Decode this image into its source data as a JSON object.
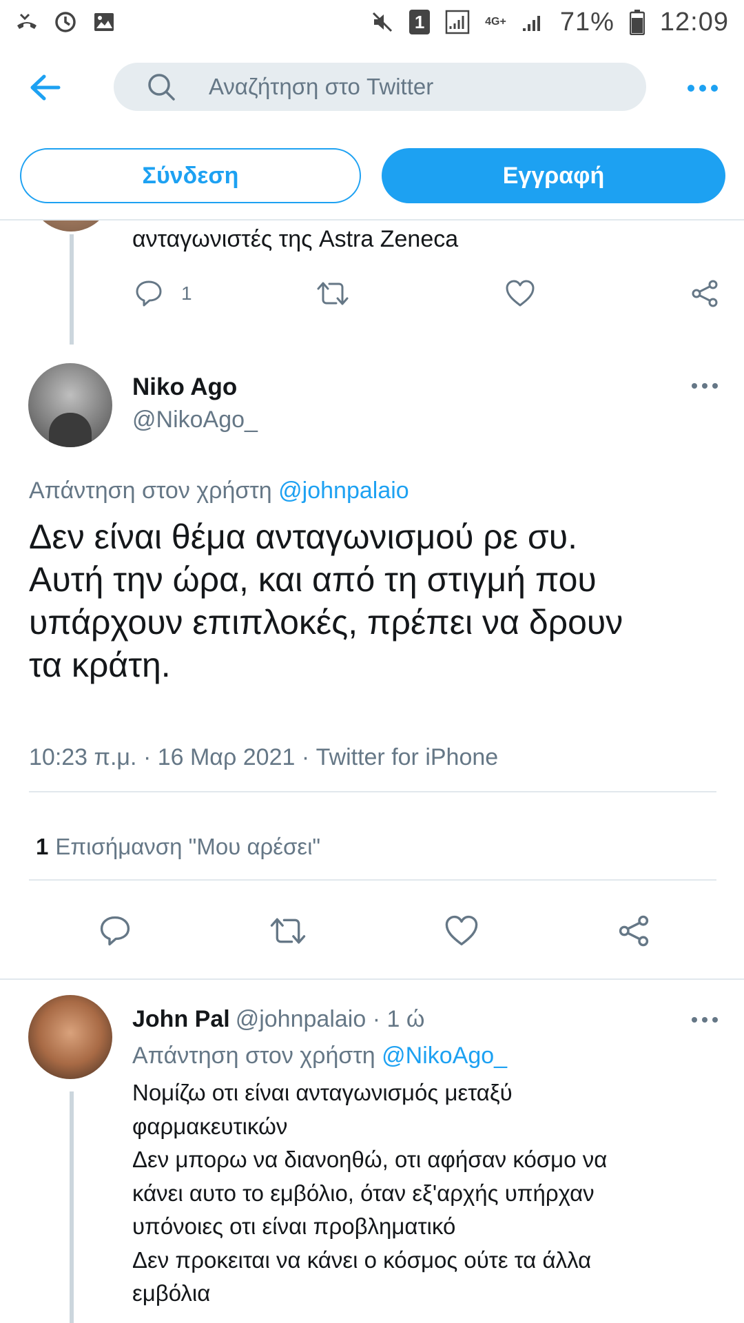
{
  "status_bar": {
    "battery": "71%",
    "time": "12:09",
    "sim_badge": "1",
    "network": "4G+"
  },
  "header": {
    "search_placeholder": "Αναζήτηση στο Twitter"
  },
  "auth": {
    "login_label": "Σύνδεση",
    "signup_label": "Εγγραφή"
  },
  "previous_tweet": {
    "text_fragment": "ανταγωνιστές της Astra Zeneca",
    "reply_count": "1"
  },
  "main_tweet": {
    "name": "Niko Ago",
    "handle": "@NikoAgo_",
    "reply_to_prefix": "Απάντηση στον χρήστη",
    "reply_to_handle": "@johnpalaio",
    "text_lines": [
      "Δεν είναι θέμα ανταγωνισμού ρε συ.",
      "Αυτή την ώρα, και από τη στιγμή που",
      "υπάρχουν επιπλοκές, πρέπει να δρουν",
      "τα κράτη."
    ],
    "time": "10:23 π.μ.",
    "date": "16 Μαρ 2021",
    "source": "Twitter for iPhone",
    "like_count": "1",
    "like_label": "Επισήμανση \"Μου αρέσει\""
  },
  "reply_tweet": {
    "name": "John Pal",
    "handle": "@johnpalaio",
    "time_ago": "1 ώ",
    "reply_to_prefix": "Απάντηση στον χρήστη",
    "reply_to_handle": "@NikoAgo_",
    "text_lines": [
      "Νομίζω οτι είναι ανταγωνισμός μεταξύ",
      "φαρμακευτικών",
      "Δεν μπορω να διανοηθώ, οτι αφήσαν κόσμο να",
      "κάνει αυτο το εμβόλιο, όταν εξ'αρχής υπήρχαν",
      "υπόνοιες οτι είναι προβληματικό",
      "Δεν προκειται να κάνει ο κόσμος ούτε τα άλλα",
      "εμβόλια"
    ]
  },
  "colors": {
    "accent": "#1da1f2",
    "secondary_text": "#657786",
    "primary_text": "#14171a",
    "search_bg": "#e6ecf0",
    "divider": "#e1e8ed"
  }
}
